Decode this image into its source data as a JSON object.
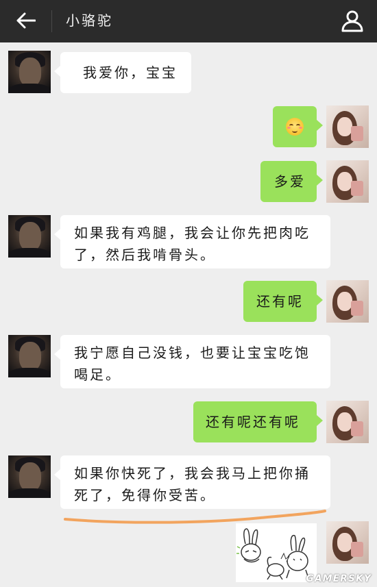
{
  "header": {
    "title": "小骆驼",
    "back_icon": "arrow-left-icon",
    "profile_icon": "person-icon"
  },
  "messages": [
    {
      "side": "left",
      "text": "我爱你，宝宝"
    },
    {
      "side": "right",
      "emoji": "blushing-smile-emoji"
    },
    {
      "side": "right",
      "text": "多爱"
    },
    {
      "side": "left",
      "lines": [
        "如果我有鸡腿，我会让你先把肉吃",
        "了，然后我啃骨头。"
      ]
    },
    {
      "side": "right",
      "text": "还有呢"
    },
    {
      "side": "left",
      "lines": [
        "我宁愿自己没钱，也要让宝宝吃饱",
        "喝足。"
      ]
    },
    {
      "side": "right",
      "text": "还有呢还有呢"
    },
    {
      "side": "left",
      "lines": [
        "如果你快死了，我会我马上把你捅",
        "死了，免得你受苦。"
      ]
    },
    {
      "side": "right",
      "sticker": "rabbit-sticker"
    }
  ],
  "colors": {
    "header_bg": "#2b2b2b",
    "chat_bg": "#eeeeee",
    "sent_bubble": "#9ae15b",
    "received_bubble": "#ffffff",
    "underline_annotation": "#f2a45e"
  },
  "watermark": "GAMERSKY"
}
